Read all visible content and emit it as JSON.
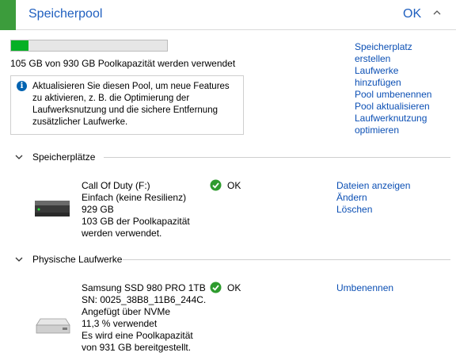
{
  "header": {
    "title": "Speicherpool",
    "status": "OK",
    "accent_color": "#3c9c3c",
    "collapse_icon": "chevron-up-icon"
  },
  "pool": {
    "usage_fraction": 0.113,
    "usage_text": "105 GB von 930 GB Poolkapazität werden verwendet",
    "info_icon": "info-icon",
    "info_lines": [
      "Aktualisieren Sie diesen Pool, um neue Features",
      "zu aktivieren, z. B. die Optimierung der",
      "Laufwerksnutzung und die sichere Entfernung",
      "zusätzlicher Laufwerke."
    ]
  },
  "actions": {
    "create_space": [
      "Speicherplatz",
      "erstellen"
    ],
    "add_drives": [
      "Laufwerke",
      "hinzufügen"
    ],
    "rename_pool": "Pool umbenennen",
    "update_pool": "Pool aktualisieren",
    "optimize": [
      "Laufwerknutzung",
      "optimieren"
    ]
  },
  "spaces_section": {
    "label": "Speicherplätze",
    "items": [
      {
        "name": "Call Of Duty (F:)",
        "resiliency": "Einfach (keine Resilienz)",
        "size": "929 GB",
        "usage_lines": [
          "103 GB der Poolkapazität",
          "werden verwendet."
        ],
        "status": "OK",
        "links": [
          "Dateien anzeigen",
          "Ändern",
          "Löschen"
        ]
      }
    ]
  },
  "drives_section": {
    "label": "Physische Laufwerke",
    "items": [
      {
        "name": "Samsung SSD 980 PRO 1TB",
        "serial": "SN: 0025_38B8_11B6_244C.",
        "bus": "Angefügt über NVMe",
        "used": "11,3 % verwendet",
        "capacity_lines": [
          "Es wird eine Poolkapazität",
          "von 931 GB bereitgestellt."
        ],
        "status": "OK",
        "links": [
          "Umbenennen"
        ]
      }
    ]
  },
  "colors": {
    "link": "#0b4fb4",
    "progress_fill": "#06b025",
    "ok_green": "#2e9b2e"
  }
}
